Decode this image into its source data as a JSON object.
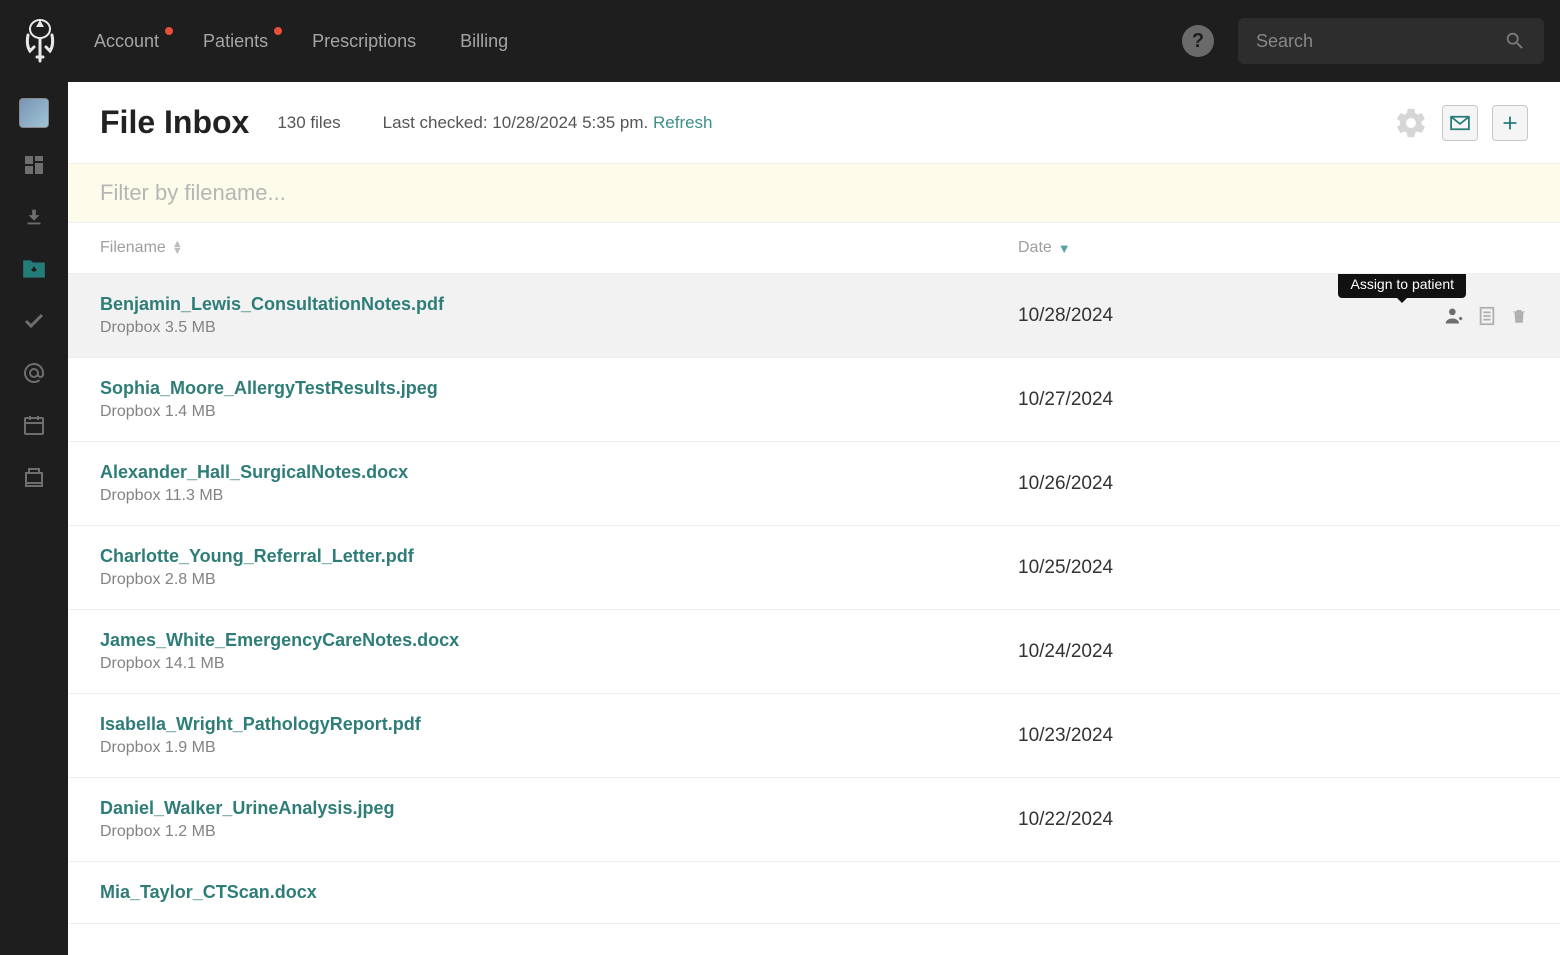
{
  "topnav": {
    "items": [
      {
        "label": "Account",
        "badge": true
      },
      {
        "label": "Patients",
        "badge": true
      },
      {
        "label": "Prescriptions",
        "badge": false
      },
      {
        "label": "Billing",
        "badge": false
      }
    ]
  },
  "search": {
    "placeholder": "Search"
  },
  "header": {
    "title": "File Inbox",
    "file_count": "130 files",
    "last_checked_label": "Last checked: 10/28/2024 5:35 pm. ",
    "refresh_label": "Refresh"
  },
  "filter": {
    "placeholder": "Filter by filename..."
  },
  "columns": {
    "filename": "Filename",
    "date": "Date"
  },
  "tooltip": {
    "assign": "Assign to patient"
  },
  "files": [
    {
      "name": "Benjamin_Lewis_ConsultationNotes.pdf",
      "meta": "Dropbox 3.5 MB",
      "date": "10/28/2024",
      "hovered": true
    },
    {
      "name": "Sophia_Moore_AllergyTestResults.jpeg",
      "meta": "Dropbox 1.4 MB",
      "date": "10/27/2024",
      "hovered": false
    },
    {
      "name": "Alexander_Hall_SurgicalNotes.docx",
      "meta": "Dropbox 11.3 MB",
      "date": "10/26/2024",
      "hovered": false
    },
    {
      "name": "Charlotte_Young_Referral_Letter.pdf",
      "meta": "Dropbox 2.8 MB",
      "date": "10/25/2024",
      "hovered": false
    },
    {
      "name": "James_White_EmergencyCareNotes.docx",
      "meta": "Dropbox 14.1 MB",
      "date": "10/24/2024",
      "hovered": false
    },
    {
      "name": "Isabella_Wright_PathologyReport.pdf",
      "meta": "Dropbox 1.9 MB",
      "date": "10/23/2024",
      "hovered": false
    },
    {
      "name": "Daniel_Walker_UrineAnalysis.jpeg",
      "meta": "Dropbox 1.2 MB",
      "date": "10/22/2024",
      "hovered": false
    },
    {
      "name": "Mia_Taylor_CTScan.docx",
      "meta": "",
      "date": "",
      "hovered": false
    }
  ],
  "colors": {
    "accent": "#2e7d78"
  }
}
